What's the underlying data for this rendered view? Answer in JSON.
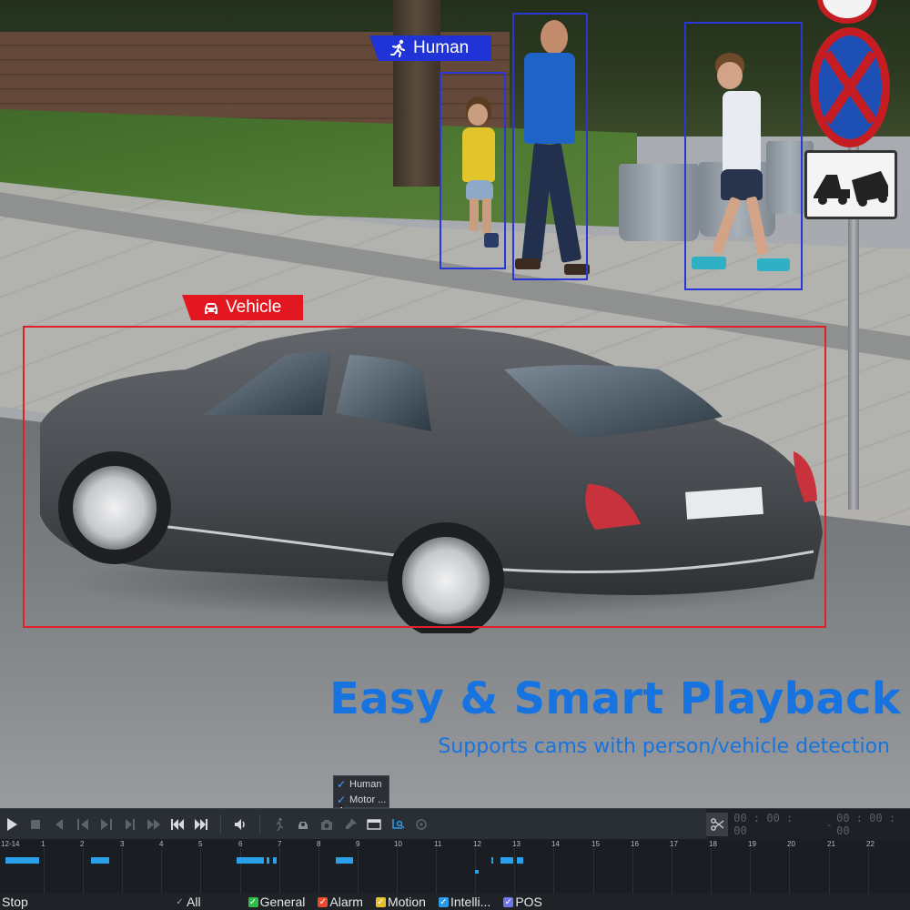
{
  "detections": {
    "human_label": "Human",
    "vehicle_label": "Vehicle",
    "human_color": "#1f33d6",
    "vehicle_color": "#e3171f"
  },
  "headline": {
    "title": "Easy & Smart Playback",
    "subtitle": "Supports cams with person/vehicle detection",
    "color": "#1673df"
  },
  "filter_popup": {
    "items": [
      {
        "label": "Human",
        "checked": true
      },
      {
        "label": "Motor ...",
        "checked": true
      }
    ]
  },
  "toolbar": {
    "icons": [
      "play-icon",
      "stop-icon",
      "step-back-icon",
      "slow-icon",
      "fast-icon",
      "step-forward-icon",
      "frame-icon",
      "previous-icon",
      "next-icon",
      "volume-icon",
      "person-search-icon",
      "vehicle-search-icon",
      "snapshot-icon",
      "tag-icon",
      "window-icon",
      "smart-search-icon",
      "zoom-icon",
      "scissors-icon"
    ],
    "start_time": "00 : 00 : 00",
    "end_time": "00 : 00 : 00",
    "end_prefix": "-"
  },
  "timeline": {
    "hour_labels": [
      "12-14",
      "1",
      "2",
      "3",
      "4",
      "5",
      "6",
      "7",
      "8",
      "9",
      "10",
      "11",
      "12",
      "13",
      "14",
      "15",
      "16",
      "17",
      "18",
      "19",
      "20",
      "21",
      "22"
    ],
    "recording_color": "#2aa0e8"
  },
  "legend": {
    "stop_label": "Stop",
    "items": [
      {
        "label": "All",
        "color": "#1f2328",
        "check": "✓"
      },
      {
        "label": "General",
        "color": "#2fbd45",
        "check": "✓"
      },
      {
        "label": "Alarm",
        "color": "#ea4a2e",
        "check": "✓"
      },
      {
        "label": "Motion",
        "color": "#e6c02a",
        "check": "✓"
      },
      {
        "label": "Intelli...",
        "color": "#2a9ce6",
        "check": "✓"
      },
      {
        "label": "POS",
        "color": "#6f77e8",
        "check": "✓"
      }
    ]
  }
}
